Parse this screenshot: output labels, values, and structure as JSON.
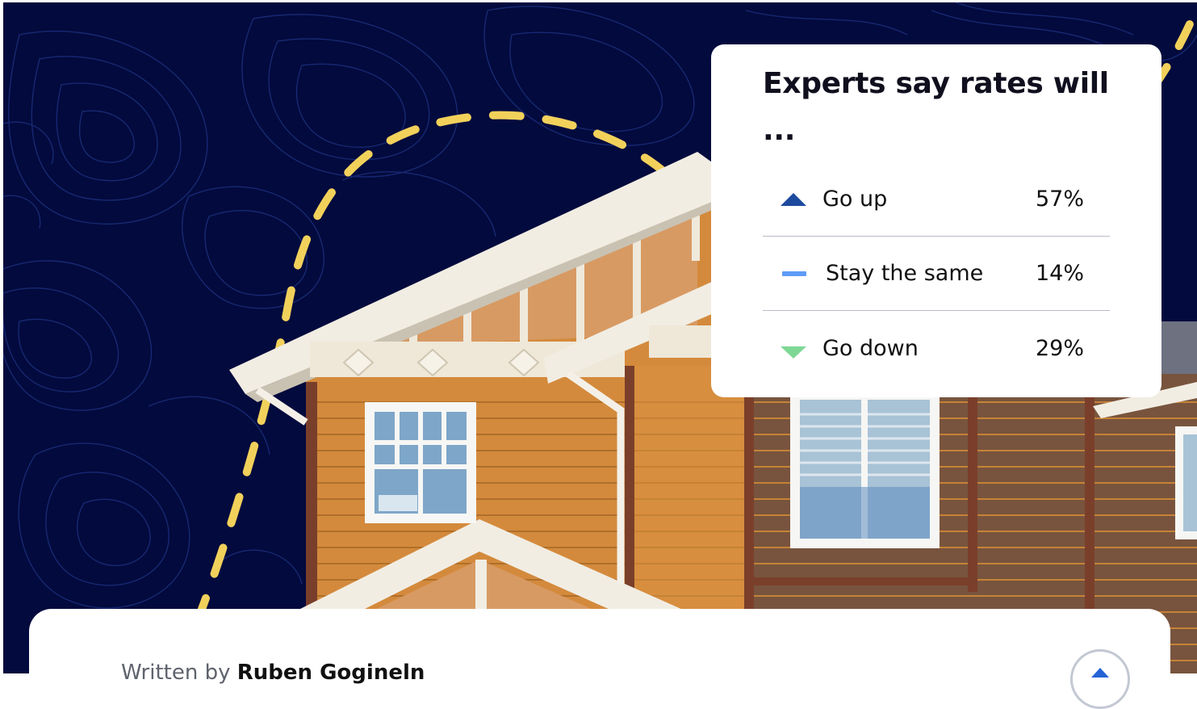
{
  "card": {
    "title": "Experts say rates will ...",
    "rows": [
      {
        "icon": "up-triangle-icon",
        "label": "Go up",
        "value": "57%",
        "color": "#1d4a9e"
      },
      {
        "icon": "dash-icon",
        "label": "Stay the same",
        "value": "14%",
        "color": "#5e9bf6"
      },
      {
        "icon": "down-triangle-icon",
        "label": "Go down",
        "value": "29%",
        "color": "#7dd895"
      }
    ]
  },
  "byline": {
    "prefix": "Written by",
    "author": "Ruben Gogineln"
  },
  "scroll_top": {
    "icon": "chevron-up-icon"
  },
  "colors": {
    "background": "#030a3d",
    "dash_accent": "#f2d15b",
    "siding": "#d48a3c"
  }
}
